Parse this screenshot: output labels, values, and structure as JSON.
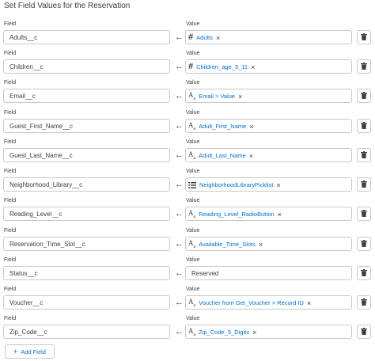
{
  "section_title": "Set Field Values for the Reservation",
  "field_label": "Field",
  "value_label": "Value",
  "add_button_label": "Add Field",
  "rows": [
    {
      "field": "Adults__c",
      "value": "Adults",
      "value_type": "resource",
      "icon": "number-icon"
    },
    {
      "field": "Children__c",
      "value": "Children_age_3_11",
      "value_type": "resource",
      "icon": "number-icon"
    },
    {
      "field": "Email__c",
      "value": "Email > Value",
      "value_type": "resource",
      "icon": "text-icon"
    },
    {
      "field": "Guest_First_Name__c",
      "value": "Adult_First_Name",
      "value_type": "resource",
      "icon": "text-icon"
    },
    {
      "field": "Guest_Last_Name__c",
      "value": "Adult_Last_Name",
      "value_type": "resource",
      "icon": "text-icon"
    },
    {
      "field": "Neighborhood_Library__c",
      "value": "NeighborhoodLibraryPicklist",
      "value_type": "resource",
      "icon": "list-icon"
    },
    {
      "field": "Reading_Level__c",
      "value": "Reading_Level_RadioButton",
      "value_type": "resource",
      "icon": "text-icon"
    },
    {
      "field": "Reservation_Time_Slot__c",
      "value": "Available_Time_Slots",
      "value_type": "resource",
      "icon": "text-icon"
    },
    {
      "field": "Status__c",
      "value": "Reserved",
      "value_type": "literal",
      "icon": ""
    },
    {
      "field": "Voucher__c",
      "value": "Voucher from Get_Voucher > Record ID",
      "value_type": "resource",
      "icon": "text-icon"
    },
    {
      "field": "Zip_Code__c",
      "value": "Zip_Code_5_Digits",
      "value_type": "resource",
      "icon": "text-icon"
    }
  ],
  "colors": {
    "link": "#0070d2",
    "border": "#c9c9c9",
    "text": "#3e3e3c"
  }
}
